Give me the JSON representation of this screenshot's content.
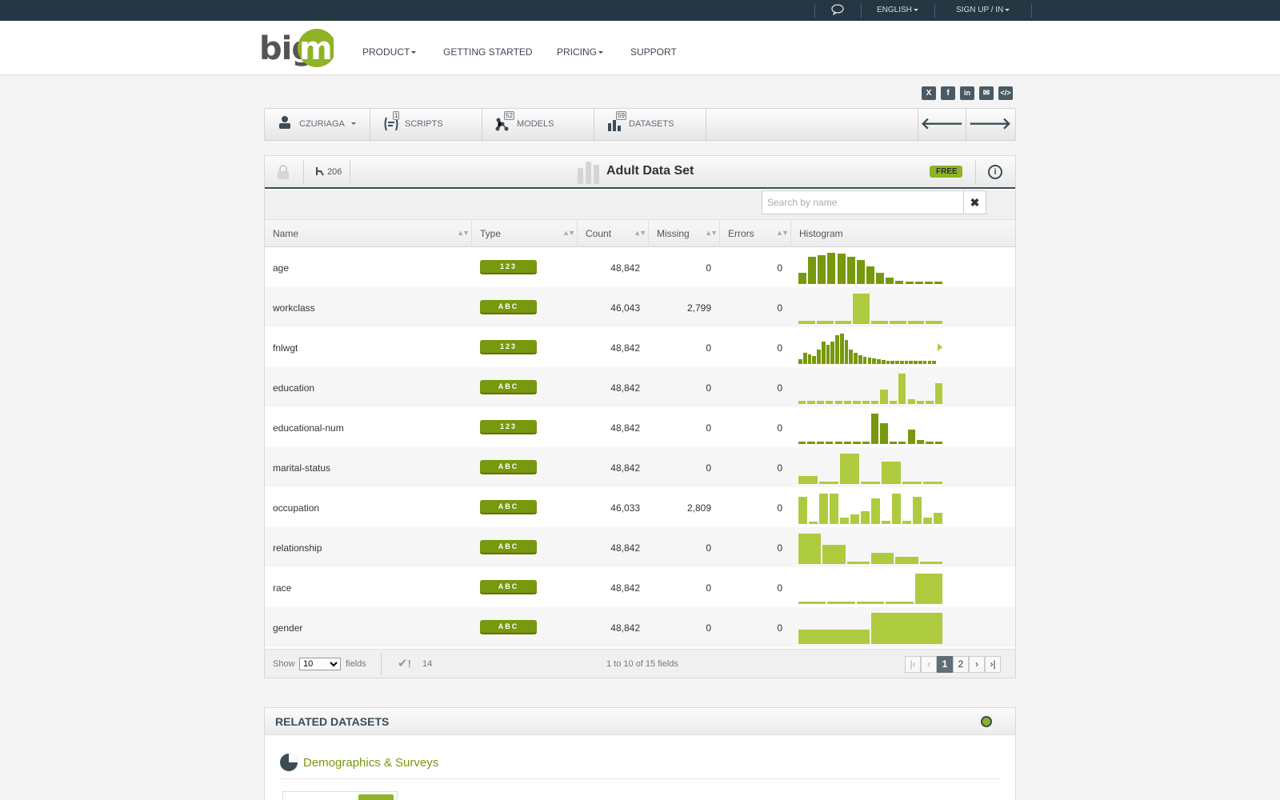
{
  "topbar": {
    "language": "ENGLISH",
    "signin": "SIGN UP / IN"
  },
  "header": {
    "logo_text": "big",
    "logo_ml": "ml",
    "nav": [
      {
        "label": "PRODUCT",
        "dropdown": true
      },
      {
        "label": "GETTING STARTED",
        "dropdown": false
      },
      {
        "label": "PRICING",
        "dropdown": true
      },
      {
        "label": "SUPPORT",
        "dropdown": false
      }
    ]
  },
  "social": [
    "x",
    "f",
    "in",
    "mail",
    "code"
  ],
  "tabs": {
    "user": "CZURIAGA",
    "scripts": {
      "label": "SCRIPTS",
      "count": "1"
    },
    "models": {
      "label": "MODELS",
      "count": "52"
    },
    "datasets": {
      "label": "DATASETS",
      "count": "59"
    }
  },
  "dataset": {
    "views": "206",
    "title": "Adult Data Set",
    "tag": "FREE"
  },
  "search": {
    "placeholder": "Search by name",
    "value": ""
  },
  "table": {
    "columns": [
      "Name",
      "Type",
      "Count",
      "Missing",
      "Errors",
      "Histogram"
    ],
    "rows": [
      {
        "name": "age",
        "type": "123",
        "count": "48,842",
        "missing": "0",
        "errors": "0",
        "hist": [
          0.35,
          0.85,
          0.9,
          0.98,
          0.95,
          0.85,
          0.75,
          0.55,
          0.35,
          0.2,
          0.1,
          0.08,
          0.08,
          0.08,
          0.08
        ],
        "numeric": true
      },
      {
        "name": "workclass",
        "type": "ABC",
        "count": "46,043",
        "missing": "2,799",
        "errors": "0",
        "hist": [
          0.1,
          0.1,
          0.1,
          0.95,
          0.1,
          0.1,
          0.1,
          0.1
        ],
        "numeric": false
      },
      {
        "name": "fnlwgt",
        "type": "123",
        "count": "48,842",
        "missing": "0",
        "errors": "0",
        "hist": [
          0.15,
          0.35,
          0.3,
          0.25,
          0.45,
          0.7,
          0.6,
          0.7,
          0.9,
          0.95,
          0.75,
          0.45,
          0.35,
          0.28,
          0.22,
          0.2,
          0.18,
          0.16,
          0.12,
          0.1,
          0.1,
          0.1,
          0.1,
          0.1,
          0.1,
          0.1,
          0.1,
          0.1,
          0.1,
          0.1
        ],
        "numeric": true,
        "more": true
      },
      {
        "name": "education",
        "type": "ABC",
        "count": "48,842",
        "missing": "0",
        "errors": "0",
        "hist": [
          0.1,
          0.1,
          0.1,
          0.1,
          0.1,
          0.1,
          0.1,
          0.1,
          0.1,
          0.45,
          0.1,
          0.95,
          0.15,
          0.1,
          0.1,
          0.65
        ],
        "numeric": false
      },
      {
        "name": "educational-num",
        "type": "123",
        "count": "48,842",
        "missing": "0",
        "errors": "0",
        "hist": [
          0.08,
          0.08,
          0.08,
          0.08,
          0.08,
          0.08,
          0.08,
          0.08,
          0.95,
          0.65,
          0.08,
          0.08,
          0.45,
          0.12,
          0.08,
          0.08
        ],
        "numeric": true
      },
      {
        "name": "marital-status",
        "type": "ABC",
        "count": "48,842",
        "missing": "0",
        "errors": "0",
        "hist": [
          0.25,
          0.08,
          0.95,
          0.08,
          0.7,
          0.08,
          0.08
        ],
        "numeric": false
      },
      {
        "name": "occupation",
        "type": "ABC",
        "count": "46,033",
        "missing": "2,809",
        "errors": "0",
        "hist": [
          0.85,
          0.08,
          0.95,
          0.95,
          0.2,
          0.3,
          0.4,
          0.8,
          0.1,
          0.95,
          0.1,
          0.85,
          0.2,
          0.35
        ],
        "numeric": false
      },
      {
        "name": "relationship",
        "type": "ABC",
        "count": "48,842",
        "missing": "0",
        "errors": "0",
        "hist": [
          0.95,
          0.6,
          0.08,
          0.35,
          0.22,
          0.08
        ],
        "numeric": false
      },
      {
        "name": "race",
        "type": "ABC",
        "count": "48,842",
        "missing": "0",
        "errors": "0",
        "hist": [
          0.08,
          0.08,
          0.08,
          0.08,
          0.95
        ],
        "numeric": false
      },
      {
        "name": "gender",
        "type": "ABC",
        "count": "48,842",
        "missing": "0",
        "errors": "0",
        "hist": [
          0.45,
          0.98
        ],
        "numeric": false
      }
    ]
  },
  "footer": {
    "show_label": "Show",
    "show_value": "10",
    "fields_label": "fields",
    "ok_count": "14",
    "range_text": "1 to 10 of 15 fields",
    "pages": [
      "1",
      "2"
    ]
  },
  "related": {
    "title": "RELATED DATASETS",
    "category": "Demographics & Surveys"
  },
  "colors": {
    "accent": "#8fb226",
    "accent_dark": "#78980e",
    "dark": "#253742"
  }
}
